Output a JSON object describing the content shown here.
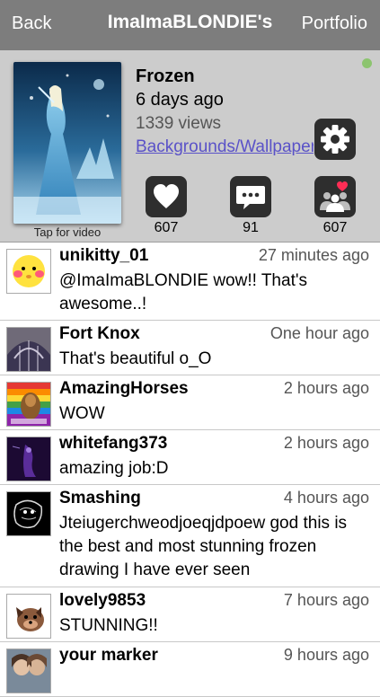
{
  "nav": {
    "back": "Back",
    "title": "ImaImaBLONDIE's",
    "portfolio": "Portfolio"
  },
  "artwork": {
    "title": "Frozen",
    "date": "6 days ago",
    "views": "1339 views",
    "category": "Backgrounds/Wallpapers",
    "tap_label": "Tap for video",
    "likes": "607",
    "comments": "91",
    "favorites": "607",
    "status_color": "#8cc46f"
  },
  "icons": {
    "like": "heart-icon",
    "comment": "speech-bubble-icon",
    "favorite": "people-heart-icon",
    "settings": "gear-icon"
  },
  "comments": [
    {
      "user": "unikitty_01",
      "time": "27 minutes ago",
      "text": "@ImaImaBLONDIE wow!! That's awesome..!"
    },
    {
      "user": "Fort Knox",
      "time": "One hour ago",
      "text": "That's beautiful o_O"
    },
    {
      "user": "AmazingHorses",
      "time": "2 hours ago",
      "text": "WOW"
    },
    {
      "user": "whitefang373",
      "time": "2 hours ago",
      "text": "amazing job:D"
    },
    {
      "user": "Smashing",
      "time": "4 hours ago",
      "text": "Jteiugerchweodjoeqjdpoew god this is the best and most stunning frozen drawing I have ever seen"
    },
    {
      "user": "lovely9853",
      "time": "7 hours ago",
      "text": "STUNNING!!"
    },
    {
      "user": "your marker",
      "time": "9 hours ago",
      "text": ""
    }
  ]
}
